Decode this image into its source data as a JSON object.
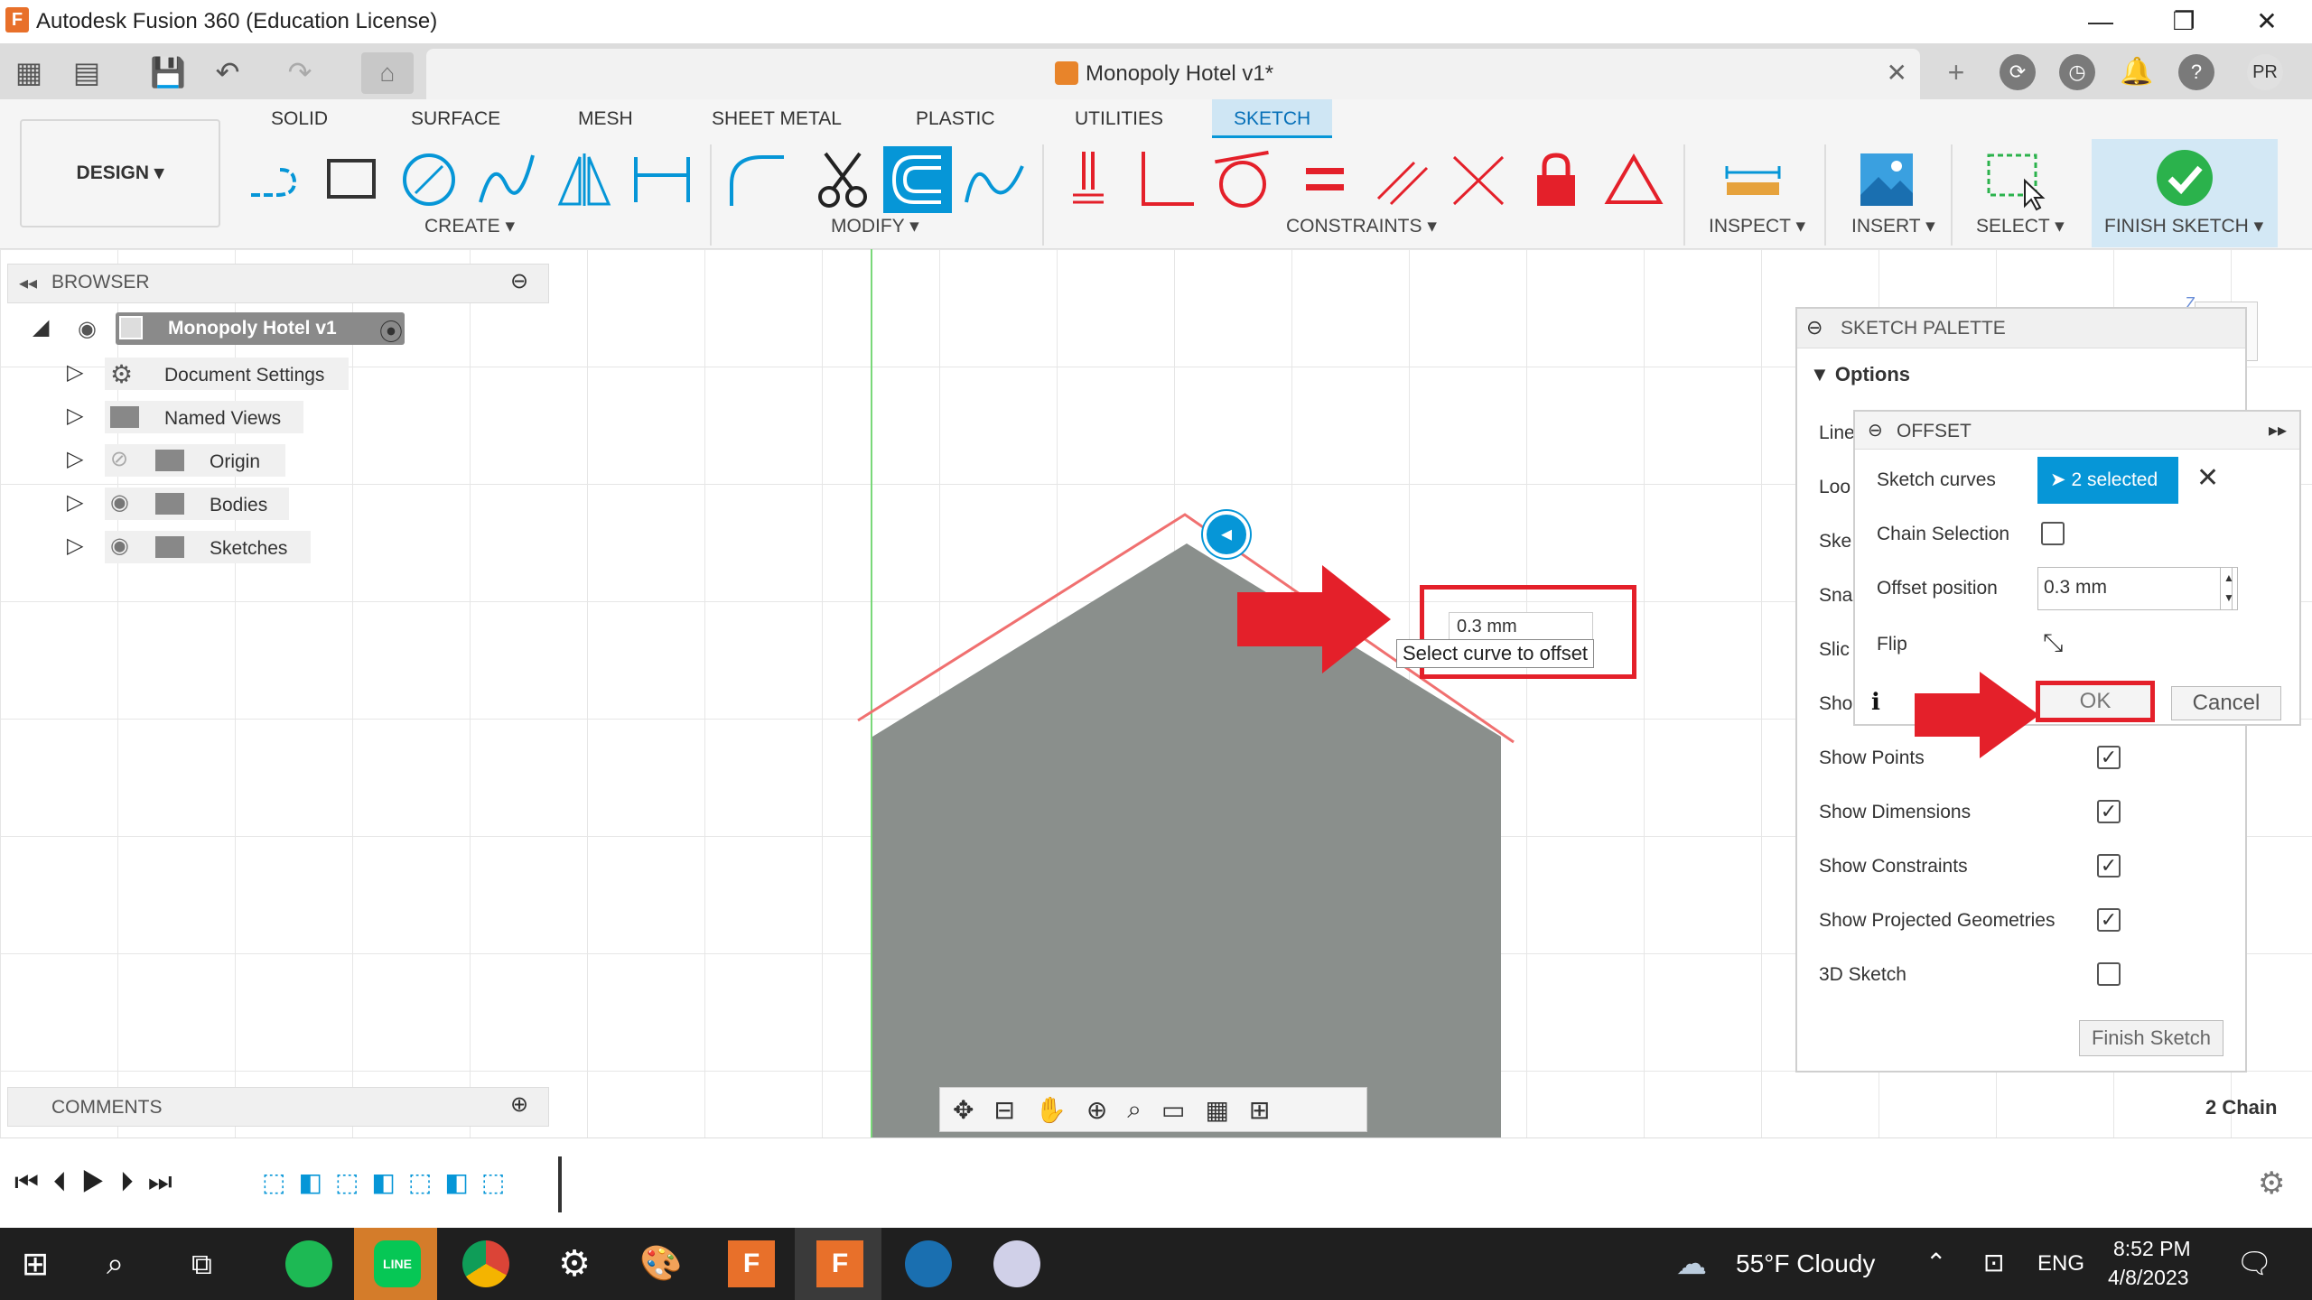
{
  "window": {
    "title": "Autodesk Fusion 360 (Education License)",
    "controls": [
      "—",
      "❐",
      "✕"
    ]
  },
  "doc_tab": {
    "title": "Monopoly Hotel v1*",
    "close": "✕"
  },
  "user_initials": "PR",
  "ribbon": {
    "workspace": "DESIGN ▾",
    "tabs": [
      "SOLID",
      "SURFACE",
      "MESH",
      "SHEET METAL",
      "PLASTIC",
      "UTILITIES",
      "SKETCH"
    ],
    "active_tab": "SKETCH",
    "groups": {
      "create": "CREATE ▾",
      "modify": "MODIFY ▾",
      "constraints": "CONSTRAINTS ▾",
      "inspect": "INSPECT ▾",
      "insert": "INSERT ▾",
      "select": "SELECT ▾",
      "finish": "FINISH SKETCH ▾"
    }
  },
  "browser": {
    "label": "BROWSER",
    "root": "Monopoly Hotel v1",
    "items": [
      "Document Settings",
      "Named Views",
      "Origin",
      "Bodies",
      "Sketches"
    ]
  },
  "comments": {
    "label": "COMMENTS"
  },
  "canvas": {
    "dim_value": "0.3 mm",
    "tooltip": "Select curve to offset",
    "status_right": "2 Chain"
  },
  "sketch_palette": {
    "title": "SKETCH PALETTE",
    "options_label": "Options",
    "truncated_rows": [
      "Line",
      "Loo",
      "Ske",
      "Sna",
      "Slic",
      "Sho"
    ],
    "checks": [
      {
        "label": "Show Points",
        "checked": "✓"
      },
      {
        "label": "Show Dimensions",
        "checked": "✓"
      },
      {
        "label": "Show Constraints",
        "checked": "✓"
      },
      {
        "label": "Show Projected Geometries",
        "checked": "✓"
      },
      {
        "label": "3D Sketch",
        "checked": ""
      }
    ],
    "finish_button": "Finish Sketch"
  },
  "offset_dialog": {
    "title": "OFFSET",
    "sketch_curves_label": "Sketch curves",
    "selected_text": "2 selected",
    "chain_label": "Chain Selection",
    "offset_pos_label": "Offset position",
    "offset_pos_value": "0.3 mm",
    "flip_label": "Flip",
    "ok": "OK",
    "cancel": "Cancel"
  },
  "taskbar": {
    "weather": "55°F  Cloudy",
    "lang": "ENG",
    "time": "8:52 PM",
    "date": "4/8/2023"
  },
  "colors": {
    "accent": "#0696d7",
    "sketch_tab": "#0696d7",
    "shape_fill": "#8a8f8c",
    "offset_line": "#f07070",
    "annotation_red": "#e4202a",
    "finish_green": "#2bb24c"
  }
}
